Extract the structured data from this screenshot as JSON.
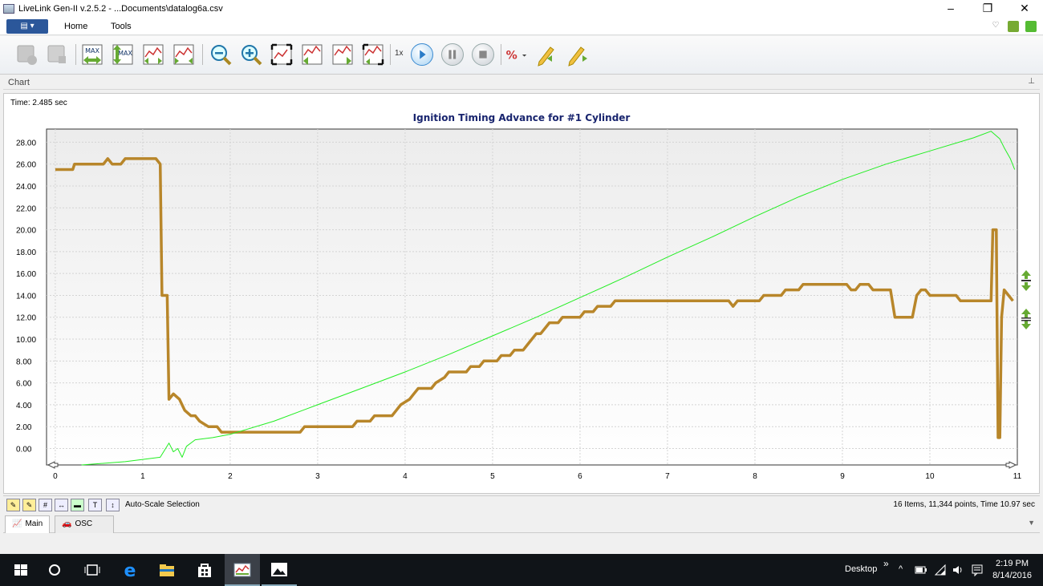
{
  "window": {
    "title": "LiveLink Gen-II  v.2.5.2 - ...Documents\\datalog6a.csv",
    "controls": [
      "–",
      "❐",
      "✕"
    ]
  },
  "ribbon": {
    "tabs": [
      "Home",
      "Tools"
    ]
  },
  "toolbar": {
    "speed_label": "1x"
  },
  "panel": {
    "title": "Chart"
  },
  "chart": {
    "time_label": "Time: 2.485 sec"
  },
  "chart_data": {
    "type": "line",
    "title": "Ignition Timing Advance for #1 Cylinder",
    "xlim": [
      -0.1,
      11.0
    ],
    "ylim": [
      -1.5,
      29.2
    ],
    "x_ticks": [
      "0",
      "1",
      "2",
      "3",
      "4",
      "5",
      "6",
      "7",
      "8",
      "9",
      "10",
      "11"
    ],
    "y_ticks": [
      "0.00",
      "2.00",
      "4.00",
      "6.00",
      "8.00",
      "10.00",
      "12.00",
      "14.00",
      "16.00",
      "18.00",
      "20.00",
      "22.00",
      "24.00",
      "26.00",
      "28.00"
    ],
    "grid": true,
    "series": [
      {
        "color": "#b8862a",
        "points": [
          [
            0,
            25.5
          ],
          [
            0.2,
            25.5
          ],
          [
            0.22,
            26.0
          ],
          [
            0.55,
            26.0
          ],
          [
            0.6,
            26.5
          ],
          [
            0.65,
            26.0
          ],
          [
            0.75,
            26.0
          ],
          [
            0.8,
            26.5
          ],
          [
            1.15,
            26.5
          ],
          [
            1.2,
            26.0
          ],
          [
            1.22,
            14.0
          ],
          [
            1.28,
            14.0
          ],
          [
            1.3,
            4.5
          ],
          [
            1.35,
            5.0
          ],
          [
            1.42,
            4.5
          ],
          [
            1.48,
            3.5
          ],
          [
            1.55,
            3.0
          ],
          [
            1.6,
            3.0
          ],
          [
            1.65,
            2.5
          ],
          [
            1.75,
            2.0
          ],
          [
            1.85,
            2.0
          ],
          [
            1.9,
            1.5
          ],
          [
            2.8,
            1.5
          ],
          [
            2.85,
            2.0
          ],
          [
            3.4,
            2.0
          ],
          [
            3.45,
            2.5
          ],
          [
            3.6,
            2.5
          ],
          [
            3.65,
            3.0
          ],
          [
            3.85,
            3.0
          ],
          [
            3.9,
            3.5
          ],
          [
            3.95,
            4.0
          ],
          [
            4.05,
            4.5
          ],
          [
            4.1,
            5.0
          ],
          [
            4.15,
            5.5
          ],
          [
            4.3,
            5.5
          ],
          [
            4.35,
            6.0
          ],
          [
            4.45,
            6.5
          ],
          [
            4.5,
            7.0
          ],
          [
            4.7,
            7.0
          ],
          [
            4.75,
            7.5
          ],
          [
            4.85,
            7.5
          ],
          [
            4.9,
            8.0
          ],
          [
            5.05,
            8.0
          ],
          [
            5.1,
            8.5
          ],
          [
            5.2,
            8.5
          ],
          [
            5.25,
            9.0
          ],
          [
            5.35,
            9.0
          ],
          [
            5.4,
            9.5
          ],
          [
            5.45,
            10.0
          ],
          [
            5.5,
            10.5
          ],
          [
            5.55,
            10.5
          ],
          [
            5.6,
            11.0
          ],
          [
            5.65,
            11.5
          ],
          [
            5.75,
            11.5
          ],
          [
            5.8,
            12.0
          ],
          [
            6.0,
            12.0
          ],
          [
            6.05,
            12.5
          ],
          [
            6.15,
            12.5
          ],
          [
            6.2,
            13.0
          ],
          [
            6.35,
            13.0
          ],
          [
            6.4,
            13.5
          ],
          [
            7.7,
            13.5
          ],
          [
            7.75,
            13.0
          ],
          [
            7.8,
            13.5
          ],
          [
            8.05,
            13.5
          ],
          [
            8.1,
            14.0
          ],
          [
            8.3,
            14.0
          ],
          [
            8.35,
            14.5
          ],
          [
            8.5,
            14.5
          ],
          [
            8.55,
            15.0
          ],
          [
            9.05,
            15.0
          ],
          [
            9.1,
            14.5
          ],
          [
            9.15,
            14.5
          ],
          [
            9.2,
            15.0
          ],
          [
            9.3,
            15.0
          ],
          [
            9.35,
            14.5
          ],
          [
            9.55,
            14.5
          ],
          [
            9.6,
            12.0
          ],
          [
            9.8,
            12.0
          ],
          [
            9.85,
            14.0
          ],
          [
            9.9,
            14.5
          ],
          [
            9.95,
            14.5
          ],
          [
            10.0,
            14.0
          ],
          [
            10.3,
            14.0
          ],
          [
            10.35,
            13.5
          ],
          [
            10.7,
            13.5
          ],
          [
            10.72,
            20.0
          ],
          [
            10.76,
            20.0
          ],
          [
            10.78,
            1.0
          ],
          [
            10.8,
            1.0
          ],
          [
            10.82,
            12.0
          ],
          [
            10.85,
            14.5
          ],
          [
            10.9,
            14.0
          ],
          [
            10.95,
            13.5
          ]
        ]
      },
      {
        "color": "#22ee22",
        "points": [
          [
            0.3,
            -1.5
          ],
          [
            0.8,
            -1.2
          ],
          [
            1.2,
            -0.8
          ],
          [
            1.3,
            0.5
          ],
          [
            1.35,
            -0.3
          ],
          [
            1.4,
            0.0
          ],
          [
            1.45,
            -0.8
          ],
          [
            1.5,
            0.2
          ],
          [
            1.6,
            0.8
          ],
          [
            1.8,
            1.0
          ],
          [
            2.0,
            1.3
          ],
          [
            2.5,
            2.5
          ],
          [
            3.0,
            4.0
          ],
          [
            3.5,
            5.5
          ],
          [
            4.0,
            7.0
          ],
          [
            4.5,
            8.6
          ],
          [
            5.0,
            10.3
          ],
          [
            5.5,
            12.0
          ],
          [
            6.0,
            13.8
          ],
          [
            6.5,
            15.6
          ],
          [
            7.0,
            17.5
          ],
          [
            7.5,
            19.3
          ],
          [
            8.0,
            21.2
          ],
          [
            8.5,
            23.0
          ],
          [
            9.0,
            24.6
          ],
          [
            9.5,
            26.0
          ],
          [
            10.0,
            27.2
          ],
          [
            10.5,
            28.4
          ],
          [
            10.7,
            29.0
          ],
          [
            10.8,
            28.3
          ],
          [
            10.85,
            27.5
          ],
          [
            10.92,
            26.5
          ],
          [
            10.97,
            25.5
          ]
        ]
      }
    ]
  },
  "bottom_bar": {
    "left_text": "Auto-Scale Selection",
    "status": "16 Items, 11,344 points, Time 10.97 sec"
  },
  "doc_tabs": [
    "Main",
    "OSC"
  ],
  "taskbar": {
    "desktop_label": "Desktop",
    "time": "2:19 PM",
    "date": "8/14/2016"
  }
}
